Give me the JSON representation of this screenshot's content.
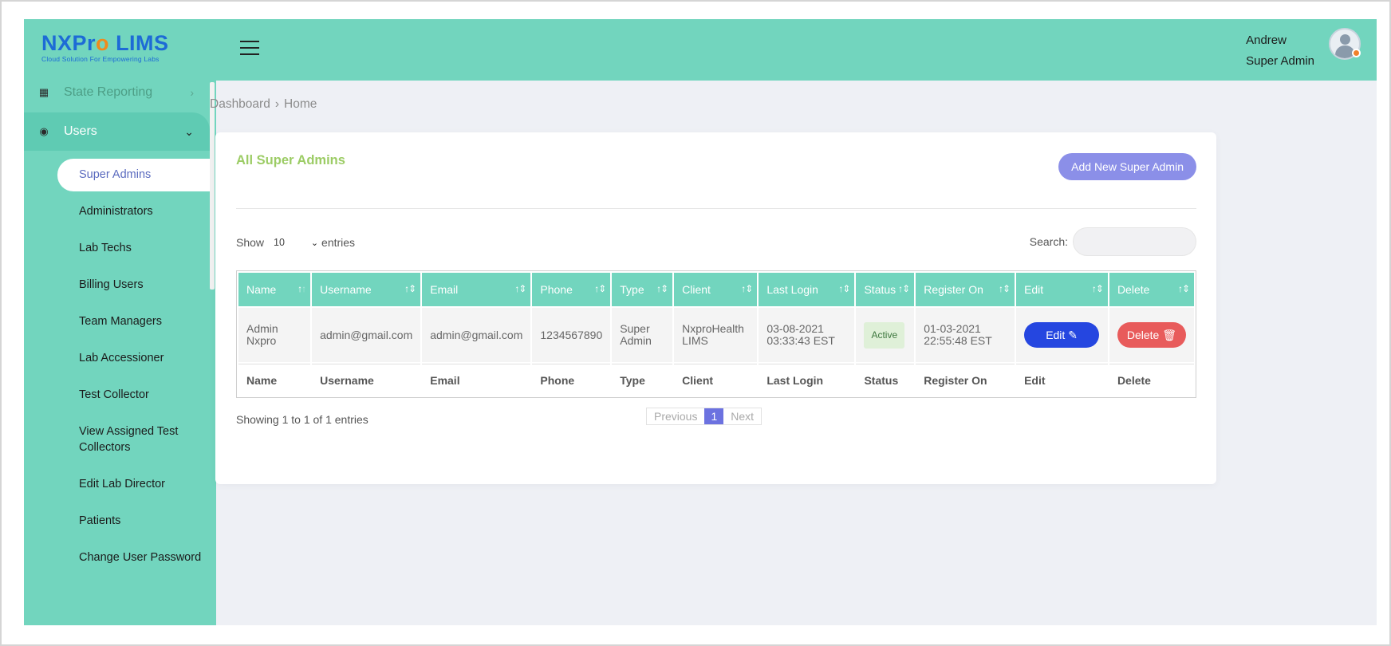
{
  "header": {
    "logo_text_1": "NX",
    "logo_text_2": "Pr",
    "logo_text_3": "LIMS",
    "logo_tagline": "Cloud Solution For Empowering Labs",
    "user_name": "Andrew",
    "user_role": "Super Admin"
  },
  "sidebar": {
    "state_reporting": "State Reporting",
    "users_label": "Users",
    "items": [
      {
        "label": "Super Admins",
        "active": true
      },
      {
        "label": "Administrators"
      },
      {
        "label": "Lab Techs"
      },
      {
        "label": "Billing Users"
      },
      {
        "label": "Team Managers"
      },
      {
        "label": "Lab Accessioner"
      },
      {
        "label": "Test Collector"
      },
      {
        "label": "View Assigned Test Collectors"
      },
      {
        "label": "Edit Lab Director"
      },
      {
        "label": "Patients"
      },
      {
        "label": "Change User Password"
      }
    ]
  },
  "breadcrumb": {
    "first": "Dashboard",
    "second": "Home"
  },
  "card": {
    "title": "All Super Admins",
    "add_button": "Add New Super Admin",
    "show_label": "Show",
    "entries_value": "10",
    "entries_label": "entries",
    "search_label": "Search:"
  },
  "table": {
    "columns": [
      "Name",
      "Username",
      "Email",
      "Phone",
      "Type",
      "Client",
      "Last Login",
      "Status",
      "Register On",
      "Edit",
      "Delete"
    ],
    "row": {
      "name": "Admin Nxpro",
      "username": "admin@gmail.com",
      "email": "admin@gmail.com",
      "phone": "1234567890",
      "type_1": "Super",
      "type_2": "Admin",
      "client_1": "NxproHealth",
      "client_2": "LIMS",
      "last_login_1": "03-08-2021",
      "last_login_2": "03:33:43 EST",
      "status": "Active",
      "register_1": "01-03-2021",
      "register_2": "22:55:48 EST",
      "edit_label": "Edit",
      "delete_label": "Delete"
    }
  },
  "footer": {
    "info": "Showing 1 to 1 of 1 entries",
    "previous": "Previous",
    "page": "1",
    "next": "Next"
  },
  "colors": {
    "primary": "#72d5be",
    "accent": "#8b8fe8",
    "edit": "#2546e0",
    "delete": "#e85b5b",
    "title": "#9ccc65"
  }
}
